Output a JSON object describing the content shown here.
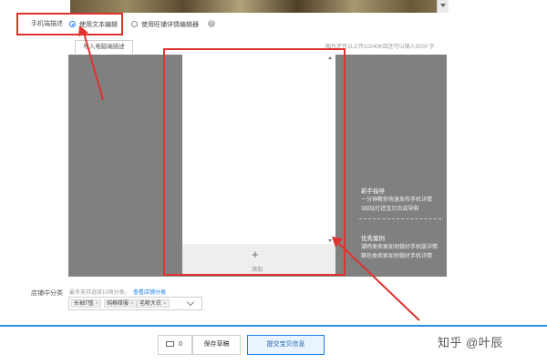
{
  "mobile_desc": {
    "label": "手机端描述",
    "option_text": "使用文本编辑",
    "option_wangpu": "使用旺铺详情编辑器",
    "help_icon": "question-circle-icon"
  },
  "editor": {
    "tab_label": "导入电脑端描述",
    "limit_text": "图片还可以上传10240K目还可以输入5000 字",
    "add_icon": "plus-icon",
    "add_label": "添加"
  },
  "tips": {
    "novice_title": "新手指导",
    "novice_1": "一分钟教你快速发布手机详情",
    "novice_2": "3招玩打造宝贝页成导购",
    "cases_title": "优秀案例",
    "cases_1": "潮鸡类卖家如何做好手机版详情",
    "cases_2": "箱包类卖家如何做好手机详情"
  },
  "shop_category": {
    "label": "店铺中分类",
    "hint": "最多支持选择10项分类，",
    "link": "查看店铺分类",
    "tags": [
      "长袖T恤",
      "纯棉褂服",
      "毛呢大衣"
    ]
  },
  "bottom_bar": {
    "message_count": "0",
    "save_draft": "保存草稿",
    "submit": "提交宝贝信息"
  },
  "watermark": "知乎 @叶辰",
  "colors": {
    "annotation_red": "#e0322e",
    "accent_blue": "#1a7de3"
  }
}
